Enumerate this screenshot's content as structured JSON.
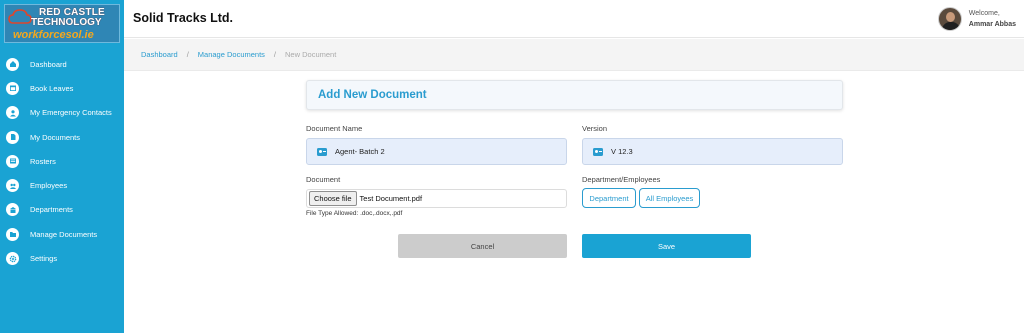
{
  "brand": {
    "logo_line1": "RED CASTLE",
    "logo_line2": "TECHNOLOGY",
    "logo_line3": "workforcesol.ie"
  },
  "sidebar": {
    "items": [
      {
        "label": "Dashboard",
        "icon": "dashboard-icon"
      },
      {
        "label": "Book Leaves",
        "icon": "calendar-icon"
      },
      {
        "label": "My Emergency Contacts",
        "icon": "contact-icon"
      },
      {
        "label": "My Documents",
        "icon": "document-icon"
      },
      {
        "label": "Rosters",
        "icon": "roster-icon"
      },
      {
        "label": "Employees",
        "icon": "employees-icon"
      },
      {
        "label": "Departments",
        "icon": "department-icon"
      },
      {
        "label": "Manage Documents",
        "icon": "folder-icon"
      },
      {
        "label": "Settings",
        "icon": "gear-icon"
      }
    ]
  },
  "header": {
    "company": "Solid Tracks Ltd.",
    "welcome": "Welcome,",
    "username": "Ammar Abbas"
  },
  "breadcrumb": {
    "items": [
      "Dashboard",
      "Manage Documents"
    ],
    "separator": "/",
    "current": "New Document"
  },
  "form": {
    "title": "Add New Document",
    "document_name_label": "Document Name",
    "document_name_value": "Agent- Batch 2",
    "version_label": "Version",
    "version_value": "V 12.3",
    "document_label": "Document",
    "choose_file_label": "Choose file",
    "file_name": "Test Document.pdf",
    "file_hint": "File Type Allowed: .doc,.docx,.pdf",
    "dept_label": "Department/Employees",
    "dept_button": "Department",
    "all_employees_button": "All Employees",
    "cancel_label": "Cancel",
    "save_label": "Save"
  },
  "colors": {
    "sidebar": "#1aa3d3",
    "accent": "#2a9ccf",
    "field_bg": "#e6eefb",
    "cancel_bg": "#cccccc"
  }
}
